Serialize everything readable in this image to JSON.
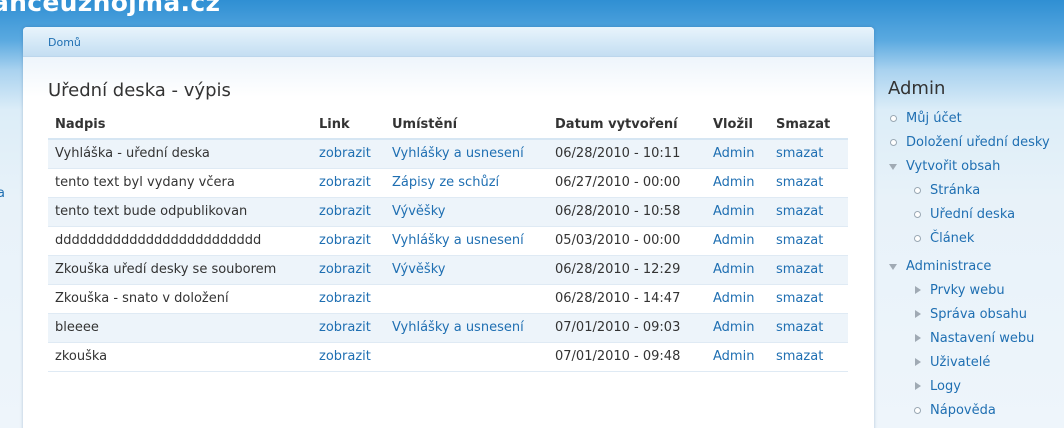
{
  "site": {
    "title": "anceuznojma.cz",
    "left_link": "a"
  },
  "breadcrumb": {
    "home": "Domů"
  },
  "page": {
    "title": "Uřední deska - výpis"
  },
  "table": {
    "headers": [
      "Nadpis",
      "Link",
      "Umístění",
      "Datum vytvoření",
      "Vložil",
      "Smazat"
    ],
    "rows": [
      {
        "title": "Vyhláška - uřední deska",
        "link": "zobrazit",
        "location": "Vyhlášky a usnesení",
        "date": "06/28/2010 - 10:11",
        "author": "Admin",
        "delete": "smazat"
      },
      {
        "title": "tento text byl vydany včera",
        "link": "zobrazit",
        "location": "Zápisy ze schůzí",
        "date": "06/27/2010 - 00:00",
        "author": "Admin",
        "delete": "smazat"
      },
      {
        "title": "tento text bude odpublikovan",
        "link": "zobrazit",
        "location": "Vývěšky",
        "date": "06/28/2010 - 10:58",
        "author": "Admin",
        "delete": "smazat"
      },
      {
        "title": "ddddddddddddddddddddddddd",
        "link": "zobrazit",
        "location": "Vyhlášky a usnesení",
        "date": "05/03/2010 - 00:00",
        "author": "Admin",
        "delete": "smazat"
      },
      {
        "title": "Zkouška uředí desky se souborem",
        "link": "zobrazit",
        "location": "Vývěšky",
        "date": "06/28/2010 - 12:29",
        "author": "Admin",
        "delete": "smazat"
      },
      {
        "title": "Zkouška - snato v doložení",
        "link": "zobrazit",
        "location": "",
        "date": "06/28/2010 - 14:47",
        "author": "Admin",
        "delete": "smazat"
      },
      {
        "title": "bleeee",
        "link": "zobrazit",
        "location": "Vyhlášky a usnesení",
        "date": "07/01/2010 - 09:03",
        "author": "Admin",
        "delete": "smazat"
      },
      {
        "title": "zkouška",
        "link": "zobrazit",
        "location": "",
        "date": "07/01/2010 - 09:48",
        "author": "Admin",
        "delete": "smazat"
      }
    ]
  },
  "sidebar": {
    "title": "Admin",
    "items": [
      {
        "label": "Můj účet"
      },
      {
        "label": "Doložení uřední desky"
      },
      {
        "label": "Vytvořit obsah",
        "children": [
          "Stránka",
          "Uřední deska",
          "Článek"
        ]
      },
      {
        "label": "Administrace",
        "children": [
          "Prvky webu",
          "Správa obsahu",
          "Nastavení webu",
          "Uživatelé",
          "Logy",
          "Nápověda"
        ]
      }
    ]
  }
}
